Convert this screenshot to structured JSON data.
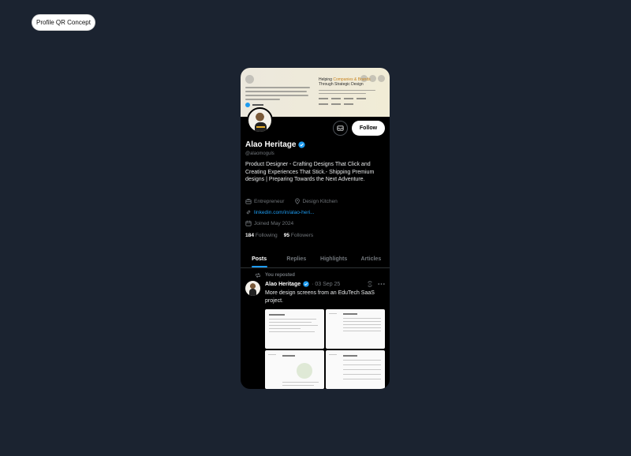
{
  "page": {
    "label": "Profile QR Concept"
  },
  "profile": {
    "name": "Alao Heritage",
    "handle": "@alaomoguls",
    "bio": "Product Designer - Crafting Designs That Click and Creating Experiences That Stick.- Shipping Premium designs | Preparing Towards the Next Adventure.",
    "occupation": "Entrepreneur",
    "location": "Design Kitchen",
    "website": "linkedin.com/in/alao-heri...",
    "joined": "Joined May 2024",
    "following_count": "184",
    "following_label": "Following",
    "followers_count": "95",
    "followers_label": "Followers",
    "follow_label": "Follow",
    "verified_color": "#1d9bf0"
  },
  "banner": {
    "heading_pre": "Helping",
    "heading_accent": "Companies & Brands",
    "heading_post": "Through Strategic Design"
  },
  "tabs": [
    {
      "label": "Posts",
      "active": true
    },
    {
      "label": "Replies",
      "active": false
    },
    {
      "label": "Highlights",
      "active": false
    },
    {
      "label": "Articles",
      "active": false
    }
  ],
  "post": {
    "repost_label": "You reposted",
    "author": "Alao Heritage",
    "date": "· 03 Sep 25",
    "text": "More design screens from an EduTech SaaS project."
  },
  "icons": {
    "message": "envelope-icon",
    "verified": "verified-badge-icon",
    "occupation": "briefcase-icon",
    "location": "location-pin-icon",
    "website": "link-icon",
    "joined": "calendar-icon",
    "repost": "repost-icon",
    "grok": "grok-icon",
    "more": "more-icon"
  }
}
